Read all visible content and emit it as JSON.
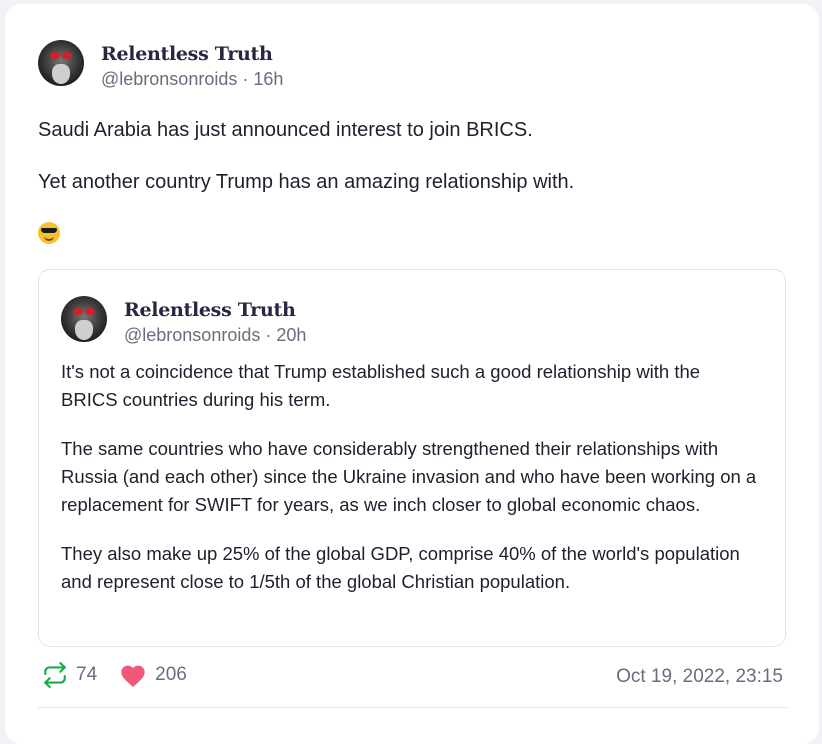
{
  "post": {
    "display_name": "Relentless Truth",
    "handle": "@lebronsonroids",
    "age": "16h",
    "paragraphs": [
      "Saudi Arabia has just announced interest to join BRICS.",
      "Yet another country Trump has an amazing relationship with."
    ],
    "emoji": "smiling-face-with-sunglasses-icon"
  },
  "quote": {
    "display_name": "Relentless Truth",
    "handle": "@lebronsonroids",
    "age": "20h",
    "paragraphs": [
      "It's not a coincidence that Trump established such a good relationship with the BRICS countries during his term.",
      "The same countries who have considerably strengthened their relationships with Russia (and each other) since the Ukraine invasion and who have been working on a replacement for SWIFT for years, as we inch closer to global economic chaos.",
      "They also make up 25% of the global GDP, comprise 40% of the world's population and represent close to 1/5th of the global Christian population."
    ]
  },
  "actions": {
    "retruth_count": "74",
    "like_count": "206",
    "timestamp": "Oct 19, 2022, 23:15"
  },
  "colors": {
    "retruth_green": "#1fa94a",
    "like_pink": "#f2587a",
    "muted_text": "#6b6b7e"
  }
}
